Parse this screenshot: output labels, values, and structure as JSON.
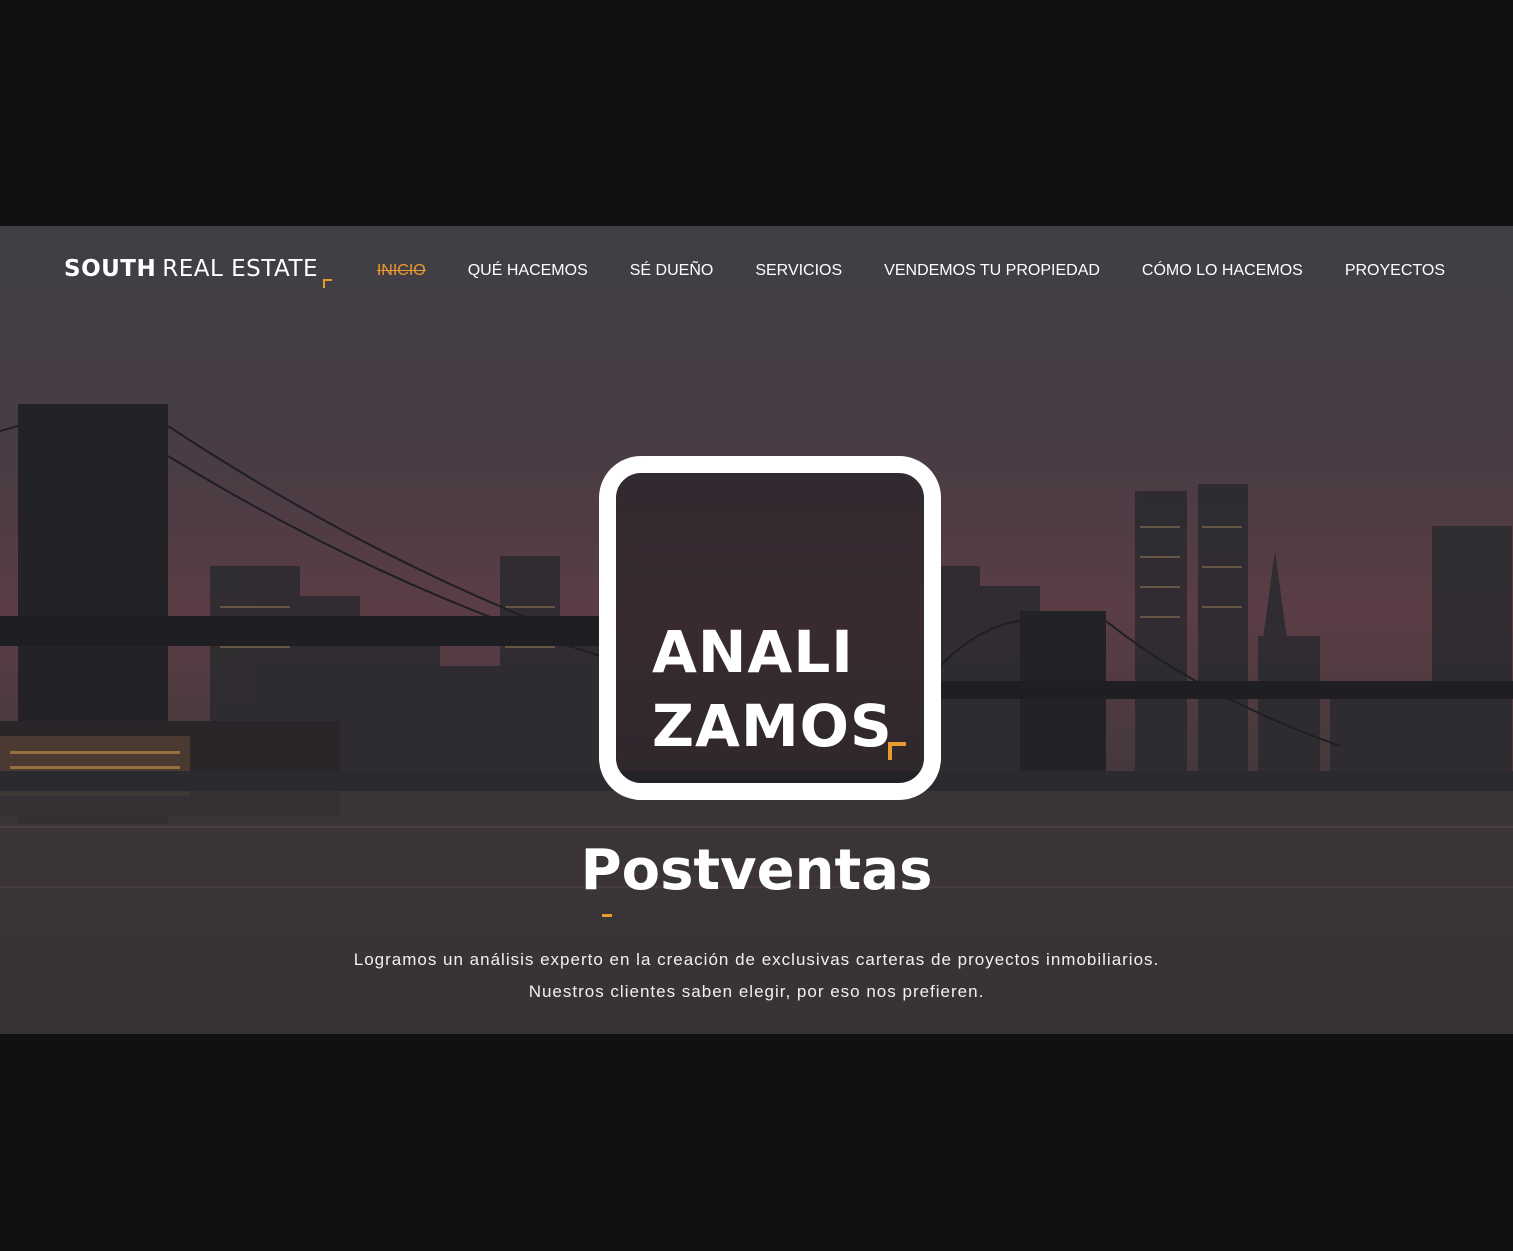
{
  "brand": {
    "bold": "SOUTH",
    "light": "REAL ESTATE"
  },
  "nav": {
    "items": [
      {
        "label": "INICIO",
        "active": true
      },
      {
        "label": "QUÉ HACEMOS"
      },
      {
        "label": "SÉ DUEÑO"
      },
      {
        "label": "SERVICIOS"
      },
      {
        "label": "VENDEMOS TU PROPIEDAD"
      },
      {
        "label": "CÓMO LO HACEMOS"
      },
      {
        "label": "PROYECTOS"
      }
    ]
  },
  "hero": {
    "badge_text": "ANALI\nZAMOS",
    "headline": "Postventas",
    "description_line1": "Logramos un análisis experto en la creación de exclusivas carteras de proyectos inmobiliarios.",
    "description_line2": "Nuestros clientes saben elegir, por eso nos prefieren."
  },
  "colors": {
    "accent": "#e89a2e",
    "page_bg": "#111111",
    "text": "#ffffff"
  }
}
